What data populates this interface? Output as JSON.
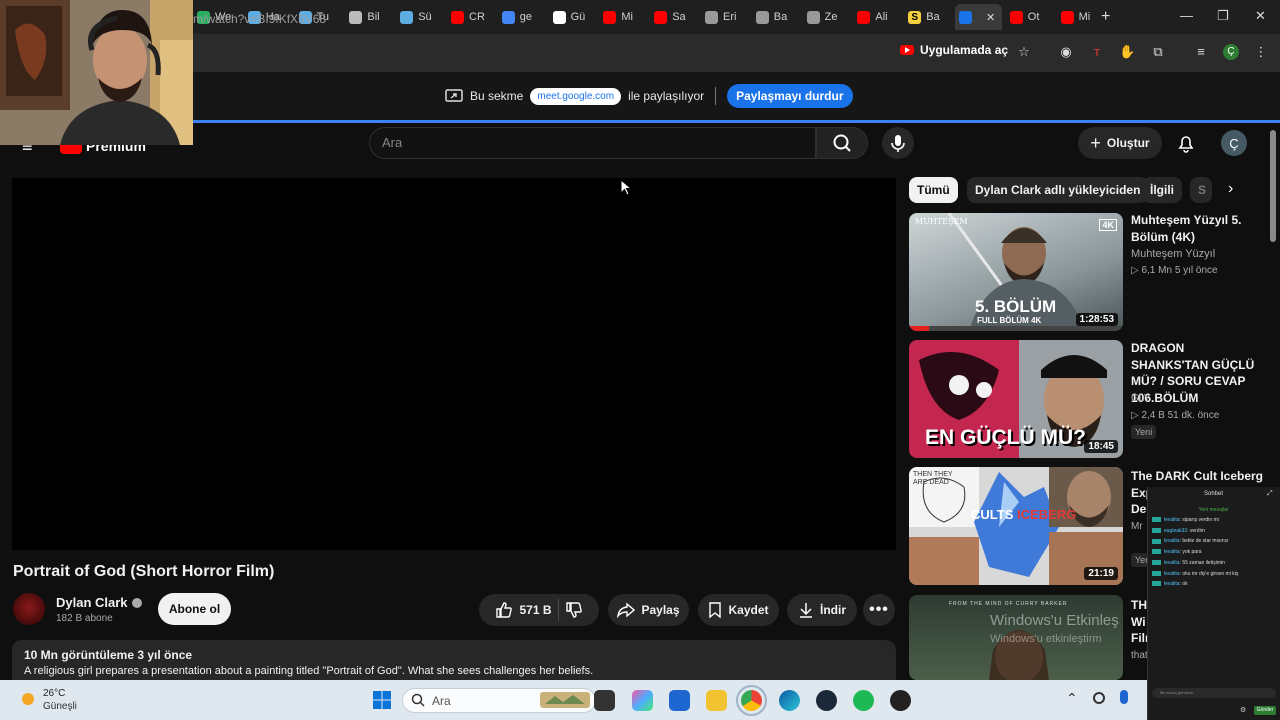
{
  "browser": {
    "tabs": [
      {
        "label": "We",
        "color": "#27ae60"
      },
      {
        "label": "Ha",
        "color": "#5dade2"
      },
      {
        "label": "Tu",
        "color": "#5dade2"
      },
      {
        "label": "Bil",
        "color": "#bbbbbb"
      },
      {
        "label": "Sü",
        "color": "#5dade2"
      },
      {
        "label": "CR",
        "color": "#ff0000"
      },
      {
        "label": "ge",
        "color": "#4285f4"
      },
      {
        "label": "Gü",
        "color": "#ffffff"
      },
      {
        "label": "Mi",
        "color": "#ff0000"
      },
      {
        "label": "Sa",
        "color": "#ff0000"
      },
      {
        "label": "Eri",
        "color": "#999999"
      },
      {
        "label": "Ba",
        "color": "#999999"
      },
      {
        "label": "Ze",
        "color": "#999999"
      },
      {
        "label": "Ali",
        "color": "#ff0000"
      },
      {
        "label": "Ba",
        "color": "#f4d03f"
      },
      {
        "label": "",
        "color": "#1a73e8"
      },
      {
        "label": "Ot",
        "color": "#ff0000"
      },
      {
        "label": "Mi",
        "color": "#ff0000"
      }
    ],
    "tab_initial_letter": "S",
    "new_tab_symbol": "+",
    "window_controls": {
      "minimize": "—",
      "maximize": "❐",
      "close": "✕"
    },
    "url": "m/watch?v=BI9fKfX5V68",
    "open_in_app_label": "Uygulamada aç"
  },
  "share_banner": {
    "prefix": "Bu sekme",
    "domain": "meet.google.com",
    "suffix": "ile paylaşılıyor",
    "stop_button": "Paylaşmayı durdur"
  },
  "youtube": {
    "logo_text": "Premium",
    "search_placeholder": "Ara",
    "create_label": "Oluştur",
    "avatar_letter": "Ç"
  },
  "video": {
    "title": "Portrait of God (Short Horror Film)",
    "channel": "Dylan Clark",
    "subscribers": "182 B abone",
    "subscribe_label": "Abone ol",
    "likes": "571 B",
    "share_label": "Paylaş",
    "save_label": "Kaydet",
    "download_label": "İndir",
    "views_and_age": "10 Mn görüntüleme  3 yıl önce",
    "description": "A religious girl prepares a presentation about a painting titled \"Portrait of God\". What she sees challenges her beliefs."
  },
  "sidebar": {
    "chips": [
      "Tümü",
      "Dylan Clark adlı yükleyiciden",
      "İlgili",
      "S"
    ],
    "recommendations": [
      {
        "title": "Muhteşem Yüzyıl 5. Bölüm (4K)",
        "channel": "Muhteşem Yüzyıl",
        "stats": "6,1 Mn  5 yıl önce",
        "duration": "1:28:53",
        "thumb_text_main": "5. BÖLÜM",
        "thumb_text_sub": "FULL BÖLÜM 4K",
        "thumb_badge": "4K",
        "thumb_logo": "MUHTEŞEM"
      },
      {
        "title": "DRAGON SHANKS'TAN GÜÇLÜ MÜ? / SORU CEVAP 106.BÖLÜM",
        "channel": "GLY",
        "stats": "2,4 B  51 dk. önce",
        "duration": "18:45",
        "badge": "Yeni",
        "thumb_text_main": "EN GÜÇLÜ MÜ?"
      },
      {
        "title": "The DARK Cult Iceberg",
        "title_line2": "Exp",
        "title_line3": "De",
        "channel": "Mr",
        "badge": "Yen",
        "duration": "21:19",
        "thumb_text_main": "CULTS",
        "thumb_text_accent": "ICEBERG",
        "thumb_sketch_text": "THEN THEY ARE DEAD"
      },
      {
        "title": "TH",
        "title_line2": "Wi",
        "title_line3": "Filr",
        "channel": "that",
        "thumb_text_main": "FROM THE MIND OF CURRY BARKER"
      }
    ]
  },
  "watermark": {
    "line1": "Windows'u Etkinleş",
    "line2": "Windows'u etkinleştirm"
  },
  "chat": {
    "title": "Sohbet",
    "new_messages": "Yeni mesajlar",
    "messages": [
      {
        "user": "levalita",
        "text": "siparış verdin mi"
      },
      {
        "user": "eagleak33",
        "text": "verdim"
      },
      {
        "user": "levalita",
        "text": "bekle de star mısınız"
      },
      {
        "user": "levalita",
        "text": "yok para"
      },
      {
        "user": "levalita",
        "text": "55 zaman iletişimin"
      },
      {
        "user": "levalita",
        "text": "oku mr diy'e girsen mi kiş"
      },
      {
        "user": "levalita",
        "text": "ok"
      }
    ],
    "input_placeholder": "Bir mesaj gönderin",
    "send_label": "Gönder"
  },
  "taskbar": {
    "temperature": "26°C",
    "condition": "Güneşli",
    "search_label": "Ara"
  }
}
